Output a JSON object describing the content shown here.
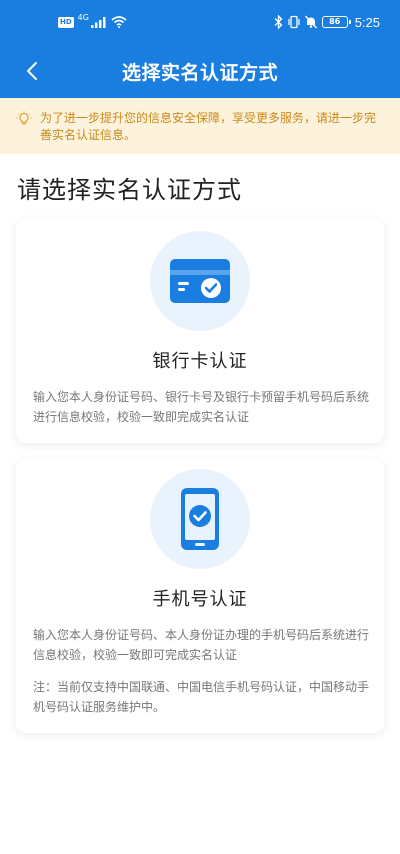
{
  "status_bar": {
    "hd_badge": "HD",
    "signal_label": "4G",
    "battery_text": "86",
    "time": "5:25"
  },
  "header": {
    "title": "选择实名认证方式"
  },
  "notice": {
    "text": "为了进一步提升您的信息安全保障，享受更多服务，请进一步完善实名认证信息。"
  },
  "section": {
    "title": "请选择实名认证方式"
  },
  "options": [
    {
      "title": "银行卡认证",
      "description": "输入您本人身份证号码、银行卡号及银行卡预留手机号码后系统进行信息校验，校验一致即完成实名认证"
    },
    {
      "title": "手机号认证",
      "description": "输入您本人身份证号码、本人身份证办理的手机号码后系统进行信息校验，校验一致即可完成实名认证",
      "note": "注：当前仅支持中国联通、中国电信手机号码认证，中国移动手机号码认证服务维护中。"
    }
  ],
  "colors": {
    "primary": "#1a7ee0",
    "notice_bg": "#fdf3dd",
    "notice_text": "#c98a1b"
  }
}
